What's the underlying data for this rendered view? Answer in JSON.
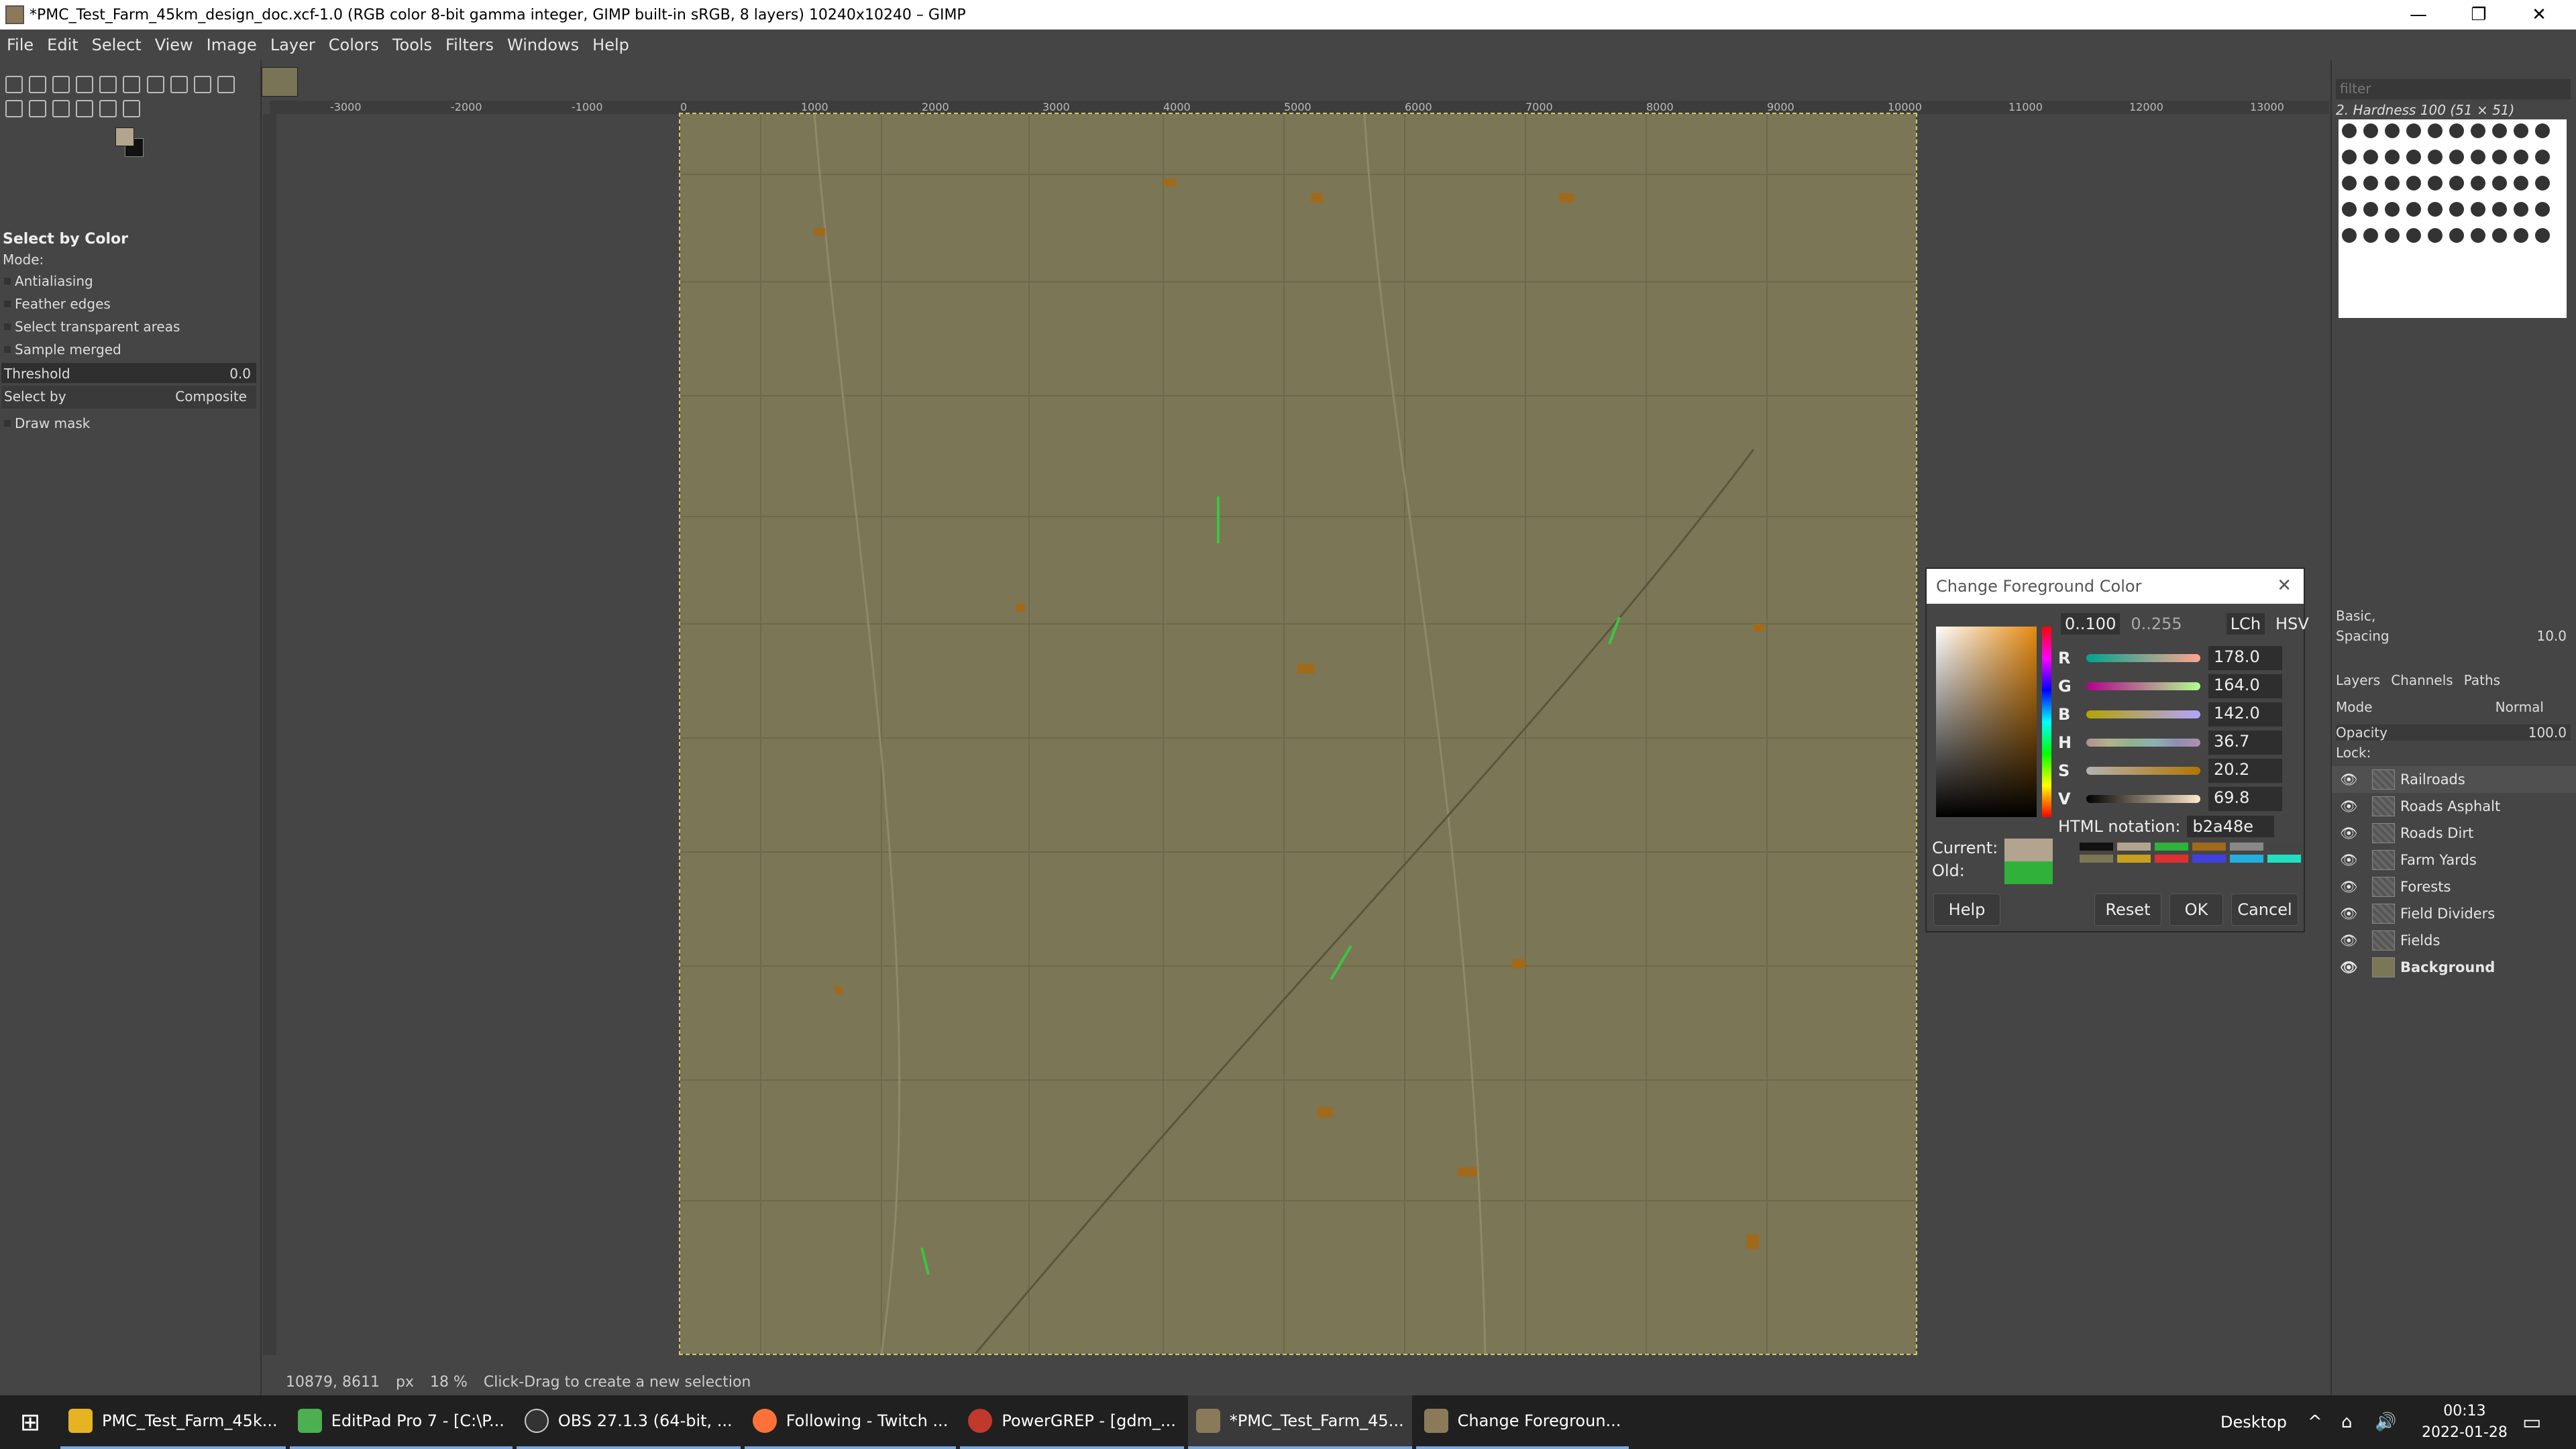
{
  "window": {
    "title": "*PMC_Test_Farm_45km_design_doc.xcf-1.0 (RGB color 8-bit gamma integer, GIMP built-in sRGB, 8 layers) 10240x10240 – GIMP",
    "minimize": "—",
    "maximize": "❐",
    "close": "✕"
  },
  "menu": [
    "File",
    "Edit",
    "Select",
    "View",
    "Image",
    "Layer",
    "Colors",
    "Tools",
    "Filters",
    "Windows",
    "Help"
  ],
  "tool_options": {
    "title": "Select by Color",
    "mode_label": "Mode:",
    "checkboxes": [
      "Antialiasing",
      "Feather edges",
      "Select transparent areas",
      "Sample merged"
    ],
    "threshold_label": "Threshold",
    "threshold_value": "0.0",
    "select_by_label": "Select by",
    "select_by_value": "Composite",
    "draw_mask": "Draw mask"
  },
  "ruler": {
    "ticks": [
      "-3000",
      "-2000",
      "-1000",
      "0",
      "1000",
      "2000",
      "3000",
      "4000",
      "5000",
      "6000",
      "7000",
      "8000",
      "9000",
      "10000",
      "11000",
      "12000",
      "13000"
    ]
  },
  "status": {
    "coords": "10879, 8611",
    "unit": "px",
    "zoom": "18 %",
    "message": "Click-Drag to create a new selection"
  },
  "dock": {
    "filter_placeholder": "filter",
    "brush_name": "2. Hardness 100 (51 × 51)",
    "preset": "Basic,",
    "spacing_label": "Spacing",
    "spacing_value": "10.0",
    "tabs": [
      "Layers",
      "Channels",
      "Paths"
    ],
    "mode_label": "Mode",
    "mode_value": "Normal",
    "opacity_label": "Opacity",
    "opacity_value": "100.0",
    "lock_label": "Lock:",
    "layers": [
      "Railroads",
      "Roads Asphalt",
      "Roads Dirt",
      "Farm Yards",
      "Forests",
      "Field Dividers",
      "Fields",
      "Background"
    ]
  },
  "color_dialog": {
    "title": "Change Foreground Color",
    "range_100": "0..100",
    "range_255": "0..255",
    "lch": "LCh",
    "hsv": "HSV",
    "channels": [
      {
        "label": "R",
        "value": "178.0"
      },
      {
        "label": "G",
        "value": "164.0"
      },
      {
        "label": "B",
        "value": "142.0"
      },
      {
        "label": "H",
        "value": "36.7"
      },
      {
        "label": "S",
        "value": "20.2"
      },
      {
        "label": "V",
        "value": "69.8"
      }
    ],
    "html_label": "HTML notation:",
    "html_value": "b2a48e",
    "current_label": "Current:",
    "old_label": "Old:",
    "current_color": "#b2a48e",
    "old_color": "#2fb13a",
    "help": "Help",
    "reset": "Reset",
    "ok": "OK",
    "cancel": "Cancel"
  },
  "taskbar": {
    "items": [
      "PMC_Test_Farm_45k...",
      "EditPad Pro 7 - [C:\\P...",
      "OBS 27.1.3 (64-bit, ...",
      "Following - Twitch ...",
      "PowerGREP - [gdm_...",
      "*PMC_Test_Farm_45...",
      "Change Foregroun..."
    ],
    "desktop": "Desktop",
    "time": "00:13",
    "date": "2022-01-28"
  }
}
